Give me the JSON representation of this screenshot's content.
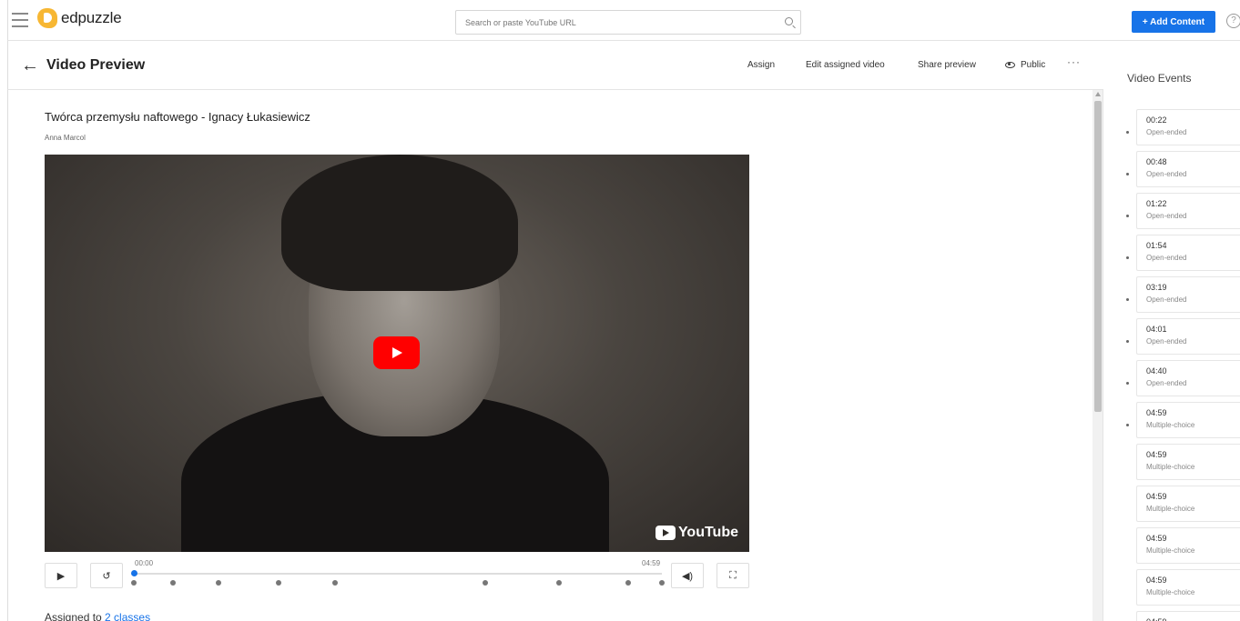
{
  "topbar": {
    "brand": "edpuzzle",
    "search_placeholder": "Search or paste YouTube URL",
    "add_content_label": "+ Add Content",
    "help_label": "?"
  },
  "header": {
    "back_label": "←",
    "title": "Video Preview",
    "assign_label": "Assign",
    "edit_label": "Edit assigned video",
    "share_label": "Share preview",
    "public_label": "Public",
    "more_label": "···"
  },
  "video": {
    "title": "Twórca przemysłu naftowego - Ignacy Łukasiewicz",
    "author": "Anna Marcol",
    "youtube_label": "YouTube",
    "time_start": "00:00",
    "time_end": "04:59",
    "play_label": "▶",
    "rewind_label": "↺",
    "volume_label": "◀)",
    "fullscreen_label": "⛶",
    "progress": 0.0
  },
  "assigned": {
    "prefix": "Assigned to ",
    "link": "2 classes"
  },
  "sidebar": {
    "title": "Video Events",
    "events": [
      {
        "time": "00:22",
        "type": "Open-ended"
      },
      {
        "time": "00:48",
        "type": "Open-ended"
      },
      {
        "time": "01:22",
        "type": "Open-ended"
      },
      {
        "time": "01:54",
        "type": "Open-ended"
      },
      {
        "time": "03:19",
        "type": "Open-ended"
      },
      {
        "time": "04:01",
        "type": "Open-ended"
      },
      {
        "time": "04:40",
        "type": "Open-ended"
      },
      {
        "time": "04:59",
        "type": "Multiple-choice"
      },
      {
        "time": "04:59",
        "type": "Multiple-choice"
      },
      {
        "time": "04:59",
        "type": "Multiple-choice"
      },
      {
        "time": "04:59",
        "type": "Multiple-choice"
      },
      {
        "time": "04:59",
        "type": "Multiple-choice"
      },
      {
        "time": "04:59",
        "type": ""
      }
    ]
  },
  "colors": {
    "accent": "#1773e8",
    "youtube_red": "#ff0000",
    "brand_yellow": "#f7b733"
  }
}
